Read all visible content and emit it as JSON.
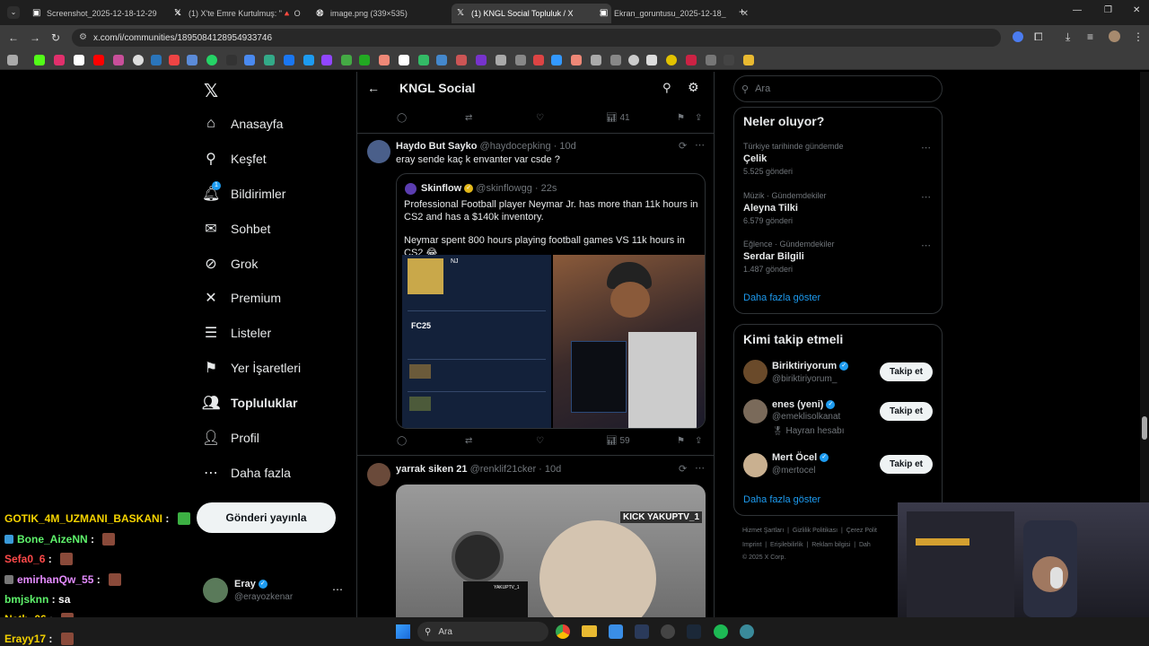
{
  "browser": {
    "tabs": [
      {
        "title": "Screenshot_2025-12-18-12-29",
        "active": false
      },
      {
        "title": "(1) X'te Emre Kurtulmuş: \"🔺 O",
        "active": false
      },
      {
        "title": "image.png (339×535)",
        "active": false
      },
      {
        "title": "(1) KNGL Social Topluluk / X",
        "active": true
      },
      {
        "title": "Ekran_goruntusu_2025-12-18_",
        "active": false
      }
    ],
    "url": "x.com/i/communities/1895084128954933746"
  },
  "nav": {
    "items": [
      {
        "label": "Anasayfa",
        "icon": "home-icon"
      },
      {
        "label": "Keşfet",
        "icon": "search-icon"
      },
      {
        "label": "Bildirimler",
        "icon": "bell-icon",
        "badge": "1"
      },
      {
        "label": "Sohbet",
        "icon": "mail-icon"
      },
      {
        "label": "Grok",
        "icon": "grok-icon"
      },
      {
        "label": "Premium",
        "icon": "x-icon"
      },
      {
        "label": "Listeler",
        "icon": "list-icon"
      },
      {
        "label": "Yer İşaretleri",
        "icon": "bookmark-icon"
      },
      {
        "label": "Topluluklar",
        "icon": "communities-icon"
      },
      {
        "label": "Profil",
        "icon": "profile-icon"
      },
      {
        "label": "Daha fazla",
        "icon": "more-icon"
      }
    ],
    "post_button": "Gönderi yayınla",
    "account": {
      "name": "Eray",
      "handle": "@erayozkenar"
    }
  },
  "feed": {
    "title": "KNGL Social",
    "prev_stats": {
      "views": "41"
    },
    "post1": {
      "author": "Haydo But Sayko",
      "handle": "@haydocepking",
      "time": "· 10d",
      "text": "eray sende kaç k envanter var csde ?",
      "quote": {
        "author": "Skinflow",
        "handle": "@skinflowgg",
        "time": "· 22s",
        "line1": "Professional Football player Neymar Jr. has more than 11k hours in CS2 and has a $140k inventory.",
        "line2": "Neymar spent 800 hours playing football games VS 11k hours in CS2 😂",
        "img_labels": {
          "nj": "NJ",
          "fc": "FC25",
          "kick": ""
        }
      },
      "views": "59"
    },
    "post2": {
      "author": "yarrak siken 21",
      "handle": "@renklif21cker",
      "time": "· 10d",
      "video_overlay": "KICK YAKUPTV_1",
      "video_overlay2": "YAKUPTV_1"
    }
  },
  "right": {
    "search_placeholder": "Ara",
    "trends_title": "Neler oluyor?",
    "trends": [
      {
        "context": "Türkiye tarihinde gündemde",
        "name": "Çelik",
        "count": "5.525 gönderi"
      },
      {
        "context": "Müzik · Gündemdekiler",
        "name": "Aleyna Tilki",
        "count": "6.579 gönderi"
      },
      {
        "context": "Eğlence · Gündemdekiler",
        "name": "Serdar Bilgili",
        "count": "1.487 gönderi"
      }
    ],
    "show_more": "Daha fazla göster",
    "follow_title": "Kimi takip etmeli",
    "follow": [
      {
        "name": "Biriktiriyorum",
        "handle": "@biriktiriyorum_",
        "extra": ""
      },
      {
        "name": "enes (yeni)",
        "handle": "@emeklisolkanat",
        "extra": "🎖 Hayran hesabı"
      },
      {
        "name": "Mert Öcel",
        "handle": "@mertocel",
        "extra": ""
      }
    ],
    "follow_btn": "Takip et",
    "show_more2": "Daha fazla göster",
    "footer": {
      "l1a": "Hizmet Şartları",
      "l1b": "Gizlilik Politikası",
      "l1c": "Çerez Polit",
      "l2a": "Imprint",
      "l2b": "Erişilebilirlik",
      "l2c": "Reklam bilgisi",
      "l2d": "Dah",
      "copy": "© 2025 X Corp."
    }
  },
  "stream_chat": [
    {
      "user": "GOTIK_4M_UZMANI_BASKANI",
      "msg": "",
      "color": "#f5d300"
    },
    {
      "user": "Bone_AizeNN",
      "msg": "",
      "color": "#5ef26b"
    },
    {
      "user": "Sefa0_6",
      "msg": "",
      "color": "#ff4a4a"
    },
    {
      "user": "emirhanQw_55",
      "msg": "",
      "color": "#e58cff"
    },
    {
      "user": "bmjsknn",
      "msg": "sa",
      "color": "#5ef26b"
    },
    {
      "user": "Nath_06",
      "msg": "",
      "color": "#f5d300"
    },
    {
      "user": "Erayy17",
      "msg": "",
      "color": "#f5d300"
    }
  ],
  "taskbar": {
    "search": "Ara"
  }
}
